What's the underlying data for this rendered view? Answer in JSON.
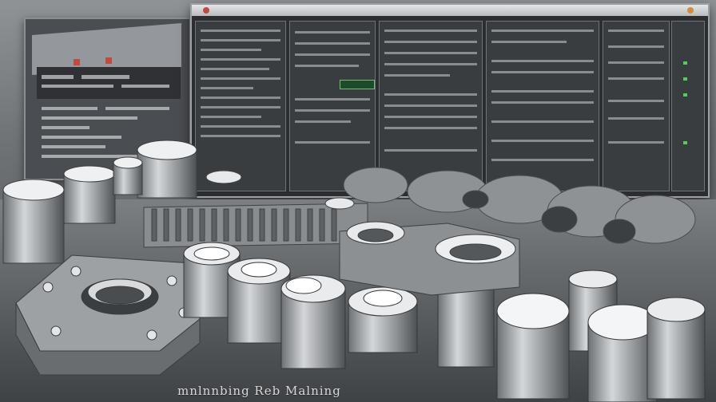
{
  "scene": {
    "description_tag": "3d-render-machinery",
    "caption": "mnlnnbing Reb Malning",
    "accent_colors": {
      "metal": "#b9bcbf",
      "metal_dark": "#6d7073",
      "screen": "#2b2d30",
      "indicator_green": "#49d35a",
      "indicator_red": "#c24a3a"
    }
  }
}
